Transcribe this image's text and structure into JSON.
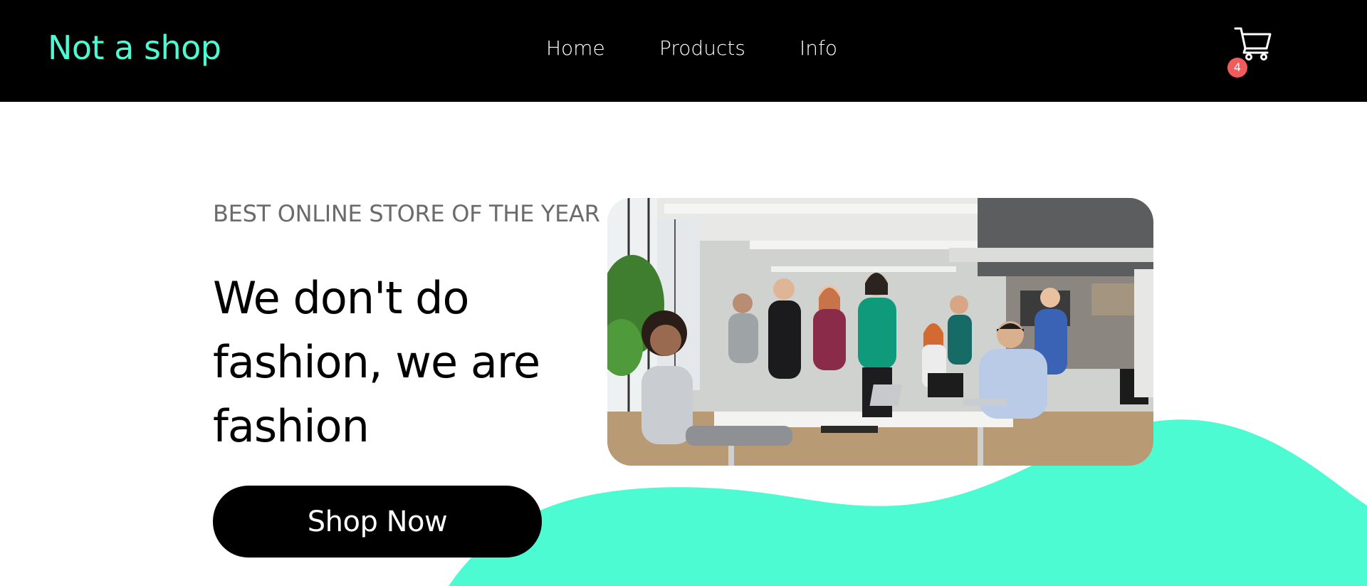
{
  "brand": {
    "name": "Not a shop",
    "color": "#4dfbd2"
  },
  "nav": {
    "items": [
      {
        "label": "Home"
      },
      {
        "label": "Products"
      },
      {
        "label": "Info"
      }
    ]
  },
  "cart": {
    "icon": "shopping-cart-icon",
    "count": "4",
    "badge_color": "#f25b5b"
  },
  "hero": {
    "eyebrow": "BEST ONLINE STORE OF THE YEAR",
    "headline": "We don't do fashion, we are fashion",
    "cta_label": "Shop Now",
    "image_subject": "team-office-photo",
    "accent_color": "#4dfbd2"
  }
}
